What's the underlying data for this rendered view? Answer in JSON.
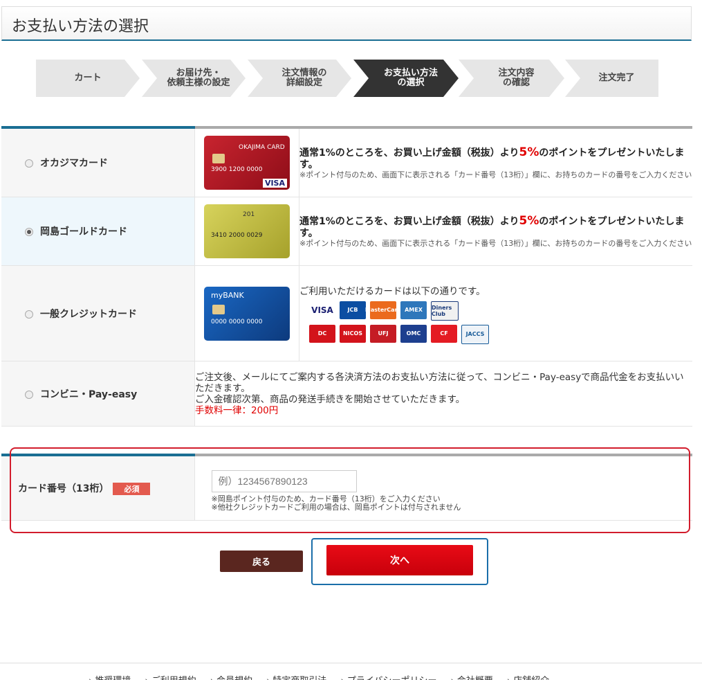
{
  "page_title": "お支払い方法の選択",
  "steps": [
    {
      "label": "カート",
      "active": false
    },
    {
      "label": "お届け先・\n依頼主様の設定",
      "active": false
    },
    {
      "label": "注文情報の\n詳細設定",
      "active": false
    },
    {
      "label": "お支払い方法\nの選択",
      "active": true
    },
    {
      "label": "注文内容\nの確認",
      "active": false
    },
    {
      "label": "注文完了",
      "active": false
    }
  ],
  "payment_methods": [
    {
      "label": "オカジマカード",
      "selected": false,
      "card_text": "OKAJIMA CARD",
      "card_number": "3900 1200 0000",
      "card_brand": "VISA",
      "headline_pre": "通常1%のところを、お買い上げ金額（税抜）より",
      "headline_rate": "5%",
      "headline_post": "のポイントをプレゼントいたします。",
      "note": "※ポイント付与のため、画面下に表示される「カード番号（13桁）」欄に、お持ちのカードの番号をご入力ください"
    },
    {
      "label": "岡島ゴールドカード",
      "selected": true,
      "card_text": "201",
      "card_number": "3410 2000 0029",
      "headline_pre": "通常1%のところを、お買い上げ金額（税抜）より",
      "headline_rate": "5%",
      "headline_post": "のポイントをプレゼントいたします。",
      "note": "※ポイント付与のため、画面下に表示される「カード番号（13桁）」欄に、お持ちのカードの番号をご入力ください"
    },
    {
      "label": "一般クレジットカード",
      "selected": false,
      "card_text": "myBANK",
      "card_number": "0000 0000 0000",
      "intro": "ご利用いただけるカードは以下の通りです。",
      "brands_row1": [
        "VISA",
        "JCB",
        "MasterCard",
        "AMEX",
        "Diners Club"
      ],
      "brands_row2": [
        "DC",
        "NICOS",
        "UFJ",
        "OMC",
        "CF",
        "JACCS"
      ]
    },
    {
      "label": "コンビニ・Pay-easy",
      "selected": false,
      "text1": "ご注文後、メールにてご案内する各決済方法のお支払い方法に従って、コンビニ・Pay-easyで商品代金をお支払いいただきます。",
      "text2": "ご入金確認次第、商品の発送手続きを開始させていただきます。",
      "fee": "手数料一律：200円"
    }
  ],
  "card_number": {
    "label": "カード番号（13桁）",
    "required": "必須",
    "placeholder": "例）1234567890123",
    "note1": "※岡島ポイント付与のため、カード番号（13桁）をご入力ください",
    "note2": "※他社クレジットカードご利用の場合は、岡島ポイントは付与されません"
  },
  "buttons": {
    "back": "戻る",
    "next": "次へ"
  },
  "footer_links": [
    "推奨環境",
    "ご利用規約",
    "会員規約",
    "特定商取引法",
    "プライバシーポリシー",
    "会社概要",
    "店舗紹介"
  ]
}
